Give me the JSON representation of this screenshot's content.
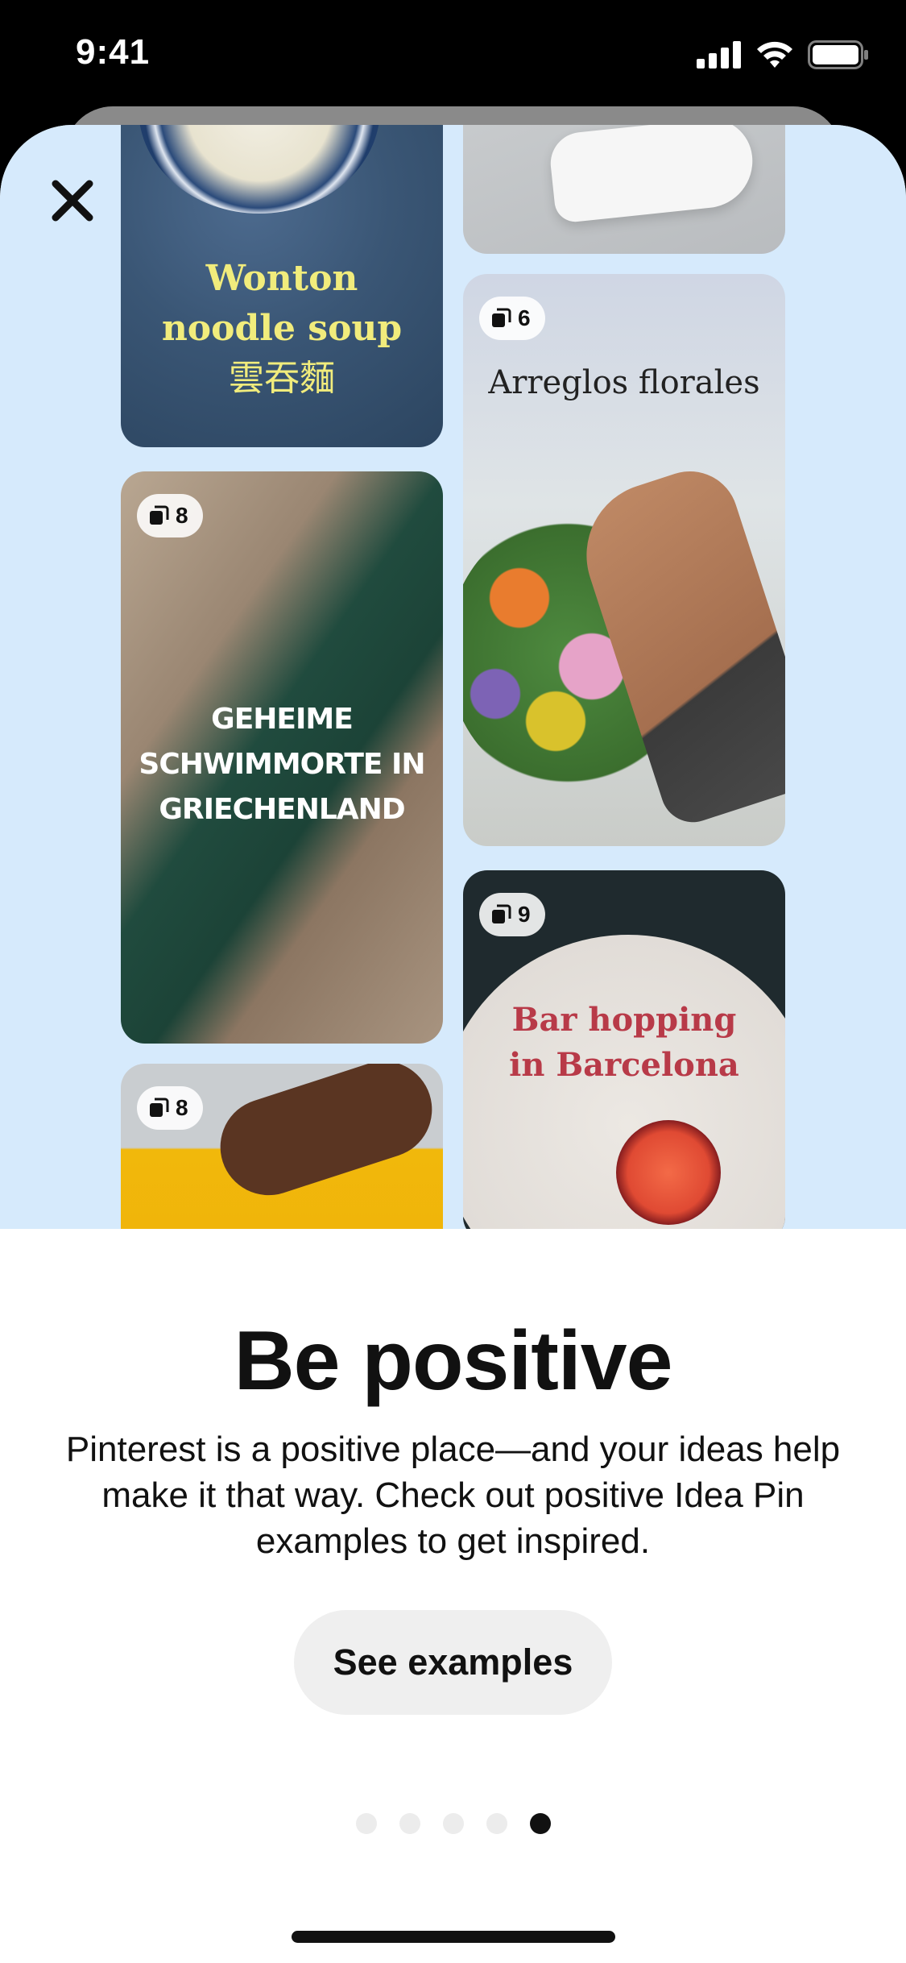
{
  "status_bar": {
    "time": "9:41",
    "icons": [
      "signal-icon",
      "wifi-icon",
      "battery-icon"
    ]
  },
  "hero": {
    "background": "#d6eafc",
    "close_icon": "close-icon",
    "pins": [
      {
        "id": "wonton",
        "title_lines": [
          "Wonton",
          "noodle soup",
          "雲吞麵"
        ],
        "count": null
      },
      {
        "id": "shoes",
        "title_lines": [],
        "count": null
      },
      {
        "id": "flowers",
        "title_lines": [
          "Arreglos florales"
        ],
        "count": "6"
      },
      {
        "id": "rocks",
        "title_lines": [
          "GEHEIME",
          "SCHWIMMORTE IN",
          "GRIECHENLAND"
        ],
        "count": "8"
      },
      {
        "id": "bar",
        "title_lines": [
          "Bar hopping",
          "in Barcelona"
        ],
        "count": "9"
      },
      {
        "id": "hand",
        "title_lines": [],
        "count": "8"
      }
    ]
  },
  "content": {
    "title": "Be positive",
    "description": "Pinterest is a positive place—and your ideas help make it that way. Check out positive Idea Pin examples to get inspired.",
    "button_label": "See examples",
    "pagination": {
      "total": 5,
      "active_index": 4
    }
  }
}
